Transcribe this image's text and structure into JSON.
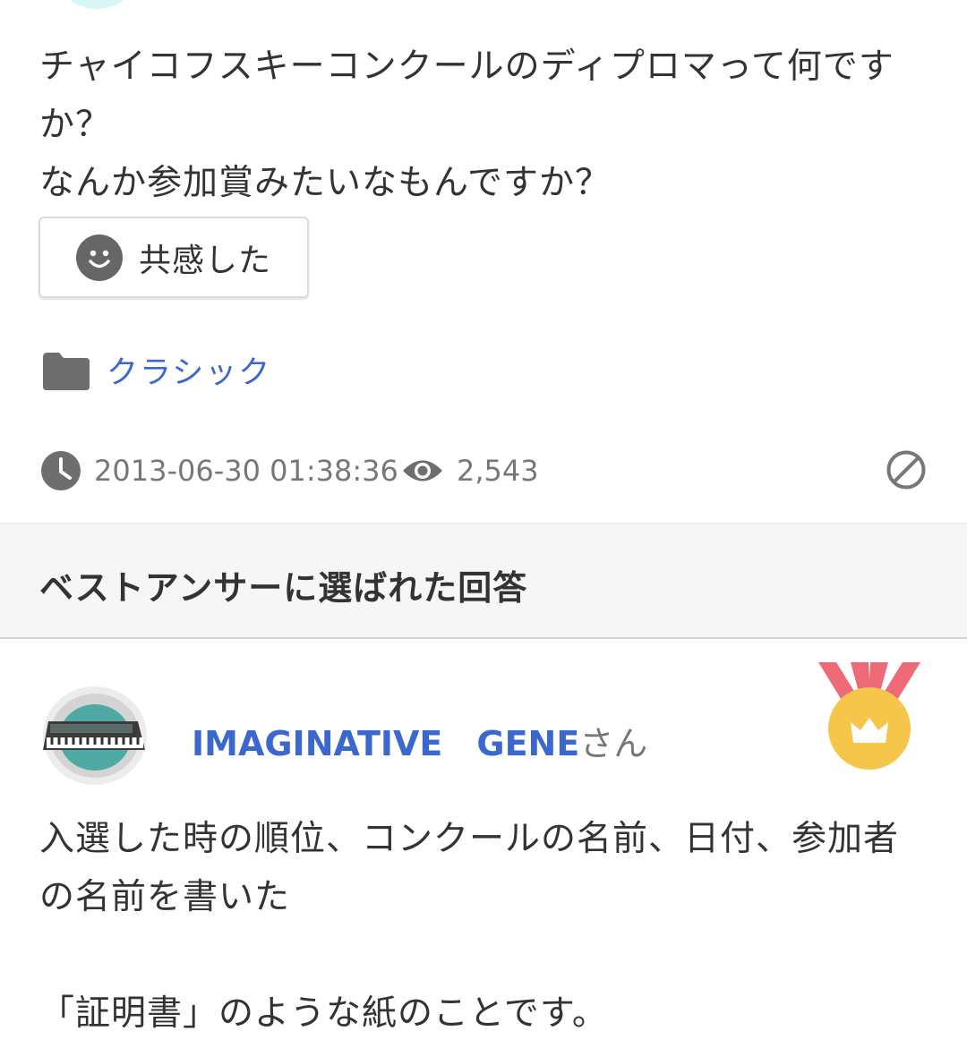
{
  "question": {
    "line1": "チャイコフスキーコンクールのディプロマって何ですか？",
    "line2": "なんか参加賞みたいなもんですか？"
  },
  "empathy_button": {
    "label": "共感した"
  },
  "category": {
    "label": "クラシック"
  },
  "meta": {
    "timestamp": "2013-06-30 01:38:36",
    "views": "2,543"
  },
  "best_answer": {
    "section_title": "ベストアンサーに選ばれた回答",
    "user_name": "IMAGINATIVE　GENE",
    "user_suffix": "さん",
    "text_line1": "入選した時の順位、コンクールの名前、日付、参加者の名前を書いた",
    "text_line2": "「証明書」のような紙のことです。"
  },
  "colors": {
    "link": "#3b68cc",
    "meta_gray": "#777777",
    "medal_gold": "#f5c64a",
    "medal_ribbon": "#ee6a77"
  }
}
